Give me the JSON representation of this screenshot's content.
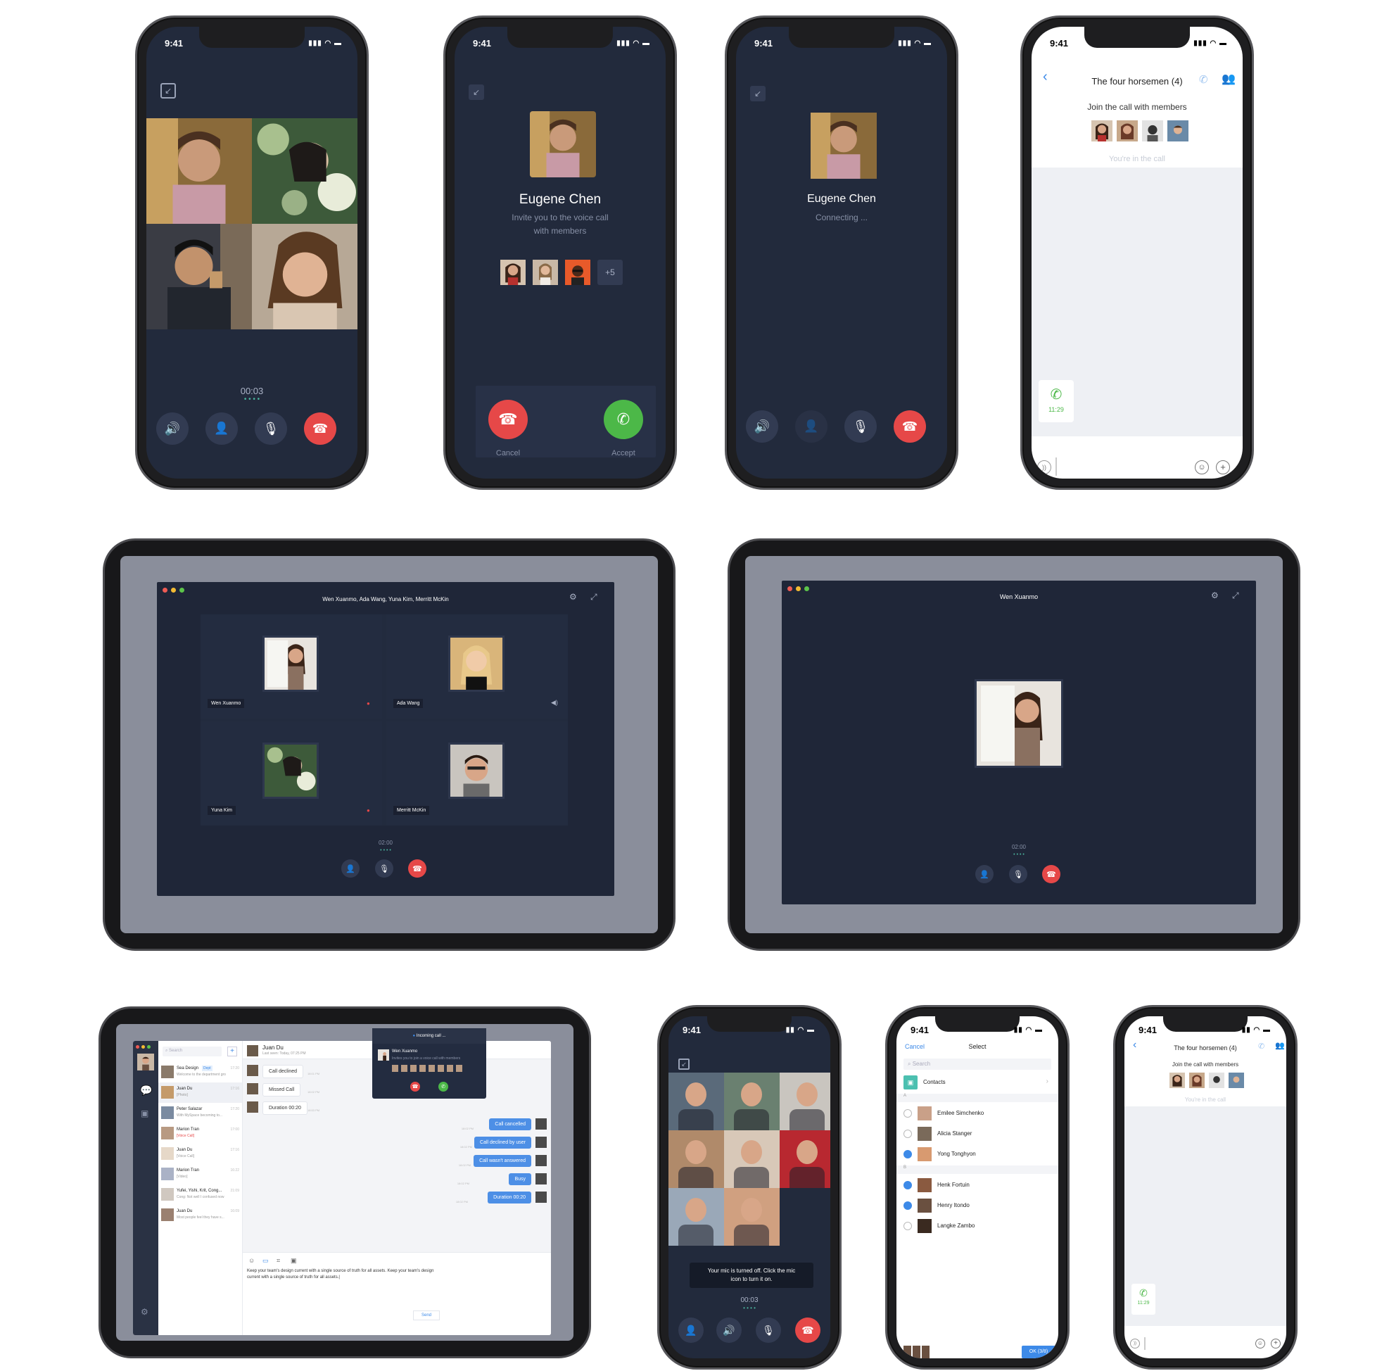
{
  "status_time": "9:41",
  "p1": {
    "timer": "00:03",
    "dots": "• • • •"
  },
  "p2": {
    "name": "Eugene Chen",
    "invite1": "Invite you to the voice call",
    "invite2": "with members",
    "more": "+5",
    "cancel": "Cancel",
    "accept": "Accept"
  },
  "p3": {
    "name": "Eugene Chen",
    "status": "Connecting ..."
  },
  "p4": {
    "title": "The four horsemen (4)",
    "join": "Join the call with members",
    "incall": "You're in the call",
    "time": "11:29"
  },
  "t1": {
    "title": "Wen Xuanmo, Ada Wang, Yuna Kim, Merritt McKin",
    "names": [
      "Wen Xuanmo",
      "Ada Wang",
      "Yuna Kim",
      "Merritt McKin"
    ],
    "timer": "02:00",
    "dots": "• • • •"
  },
  "t2": {
    "title": "Wen Xuanmo",
    "timer": "02:00",
    "dots": "• • • •"
  },
  "t3": {
    "search": "Search",
    "chats": [
      {
        "name": "Sea Design",
        "tag": "Dept",
        "msg": "Welcome to the department group",
        "time": "17:20"
      },
      {
        "name": "Juan Du",
        "msg": "[Photo]",
        "time": "17:16"
      },
      {
        "name": "Peter Salazar",
        "msg": "With MySpace becoming to...",
        "time": "17:20"
      },
      {
        "name": "Marion Tran",
        "msg": "[Voice Call]",
        "time": "17:00"
      },
      {
        "name": "Juan Du",
        "msg": "[Voice Call]",
        "time": "17:16"
      },
      {
        "name": "Marion Tran",
        "msg": "[Video]",
        "time": "16:22"
      },
      {
        "name": "Yufei, Yishi, Krit, Cong...",
        "msg": "Cong: Not well I confused now",
        "time": "21:09"
      },
      {
        "name": "Juan Du",
        "msg": "Most people feel they have s...",
        "time": "16:09"
      }
    ],
    "conv_name": "Juan Du",
    "last_seen": "Last seen: Today, 07:25 PM",
    "left_msgs": [
      {
        "text": "Call declined",
        "time": "18:01 PM"
      },
      {
        "text": "Missed Call",
        "time": "18:02 PM"
      },
      {
        "text": "Duration 00:20",
        "time": "18:53 PM"
      }
    ],
    "right_msgs": [
      {
        "text": "Call cancelled",
        "time": "18:02 PM"
      },
      {
        "text": "Call declined by user",
        "time": "18:02 PM"
      },
      {
        "text": "Call wasn't answered",
        "time": "18:02 PM"
      },
      {
        "text": "Busy",
        "time": "18:02 PM"
      },
      {
        "text": "Duration 00:20",
        "time": "18:02 PM"
      }
    ],
    "compose": "Keep your team's design current with a single source of truth for all assets. Keep your team's design current with a single source of truth for all assets.|",
    "send": "Send",
    "incoming": "Incoming call ...",
    "inc_name": "Wen Xuanmo",
    "inc_msg": "Invites you to join a voice call with members"
  },
  "p5": {
    "notice1": "Your mic is turned off. Click the mic",
    "notice2": "icon to turn it on.",
    "timer": "00:03",
    "dots": "• • • •"
  },
  "p6": {
    "cancel": "Cancel",
    "title": "Select",
    "search": "Search",
    "contacts": "Contacts",
    "secA": "A",
    "secB": "B",
    "people": [
      {
        "name": "Emilee Simchenko",
        "checked": false
      },
      {
        "name": "Alicia Stanger",
        "checked": false
      },
      {
        "name": "Yong Tonghyon",
        "checked": true
      },
      {
        "name": "Henk Fortuin",
        "checked": true
      },
      {
        "name": "Henry Itondo",
        "checked": true
      },
      {
        "name": "Langke Zambo",
        "checked": false
      }
    ],
    "ok": "OK (3/8)"
  },
  "p7": {
    "title": "The four horsemen (4)",
    "join": "Join the call with members",
    "incall": "You're in the call",
    "time": "11:29"
  },
  "colors": {
    "dark_bg": "#222a3c",
    "red": "#e64848",
    "green": "#4cb848",
    "blue": "#3d8ae8"
  }
}
